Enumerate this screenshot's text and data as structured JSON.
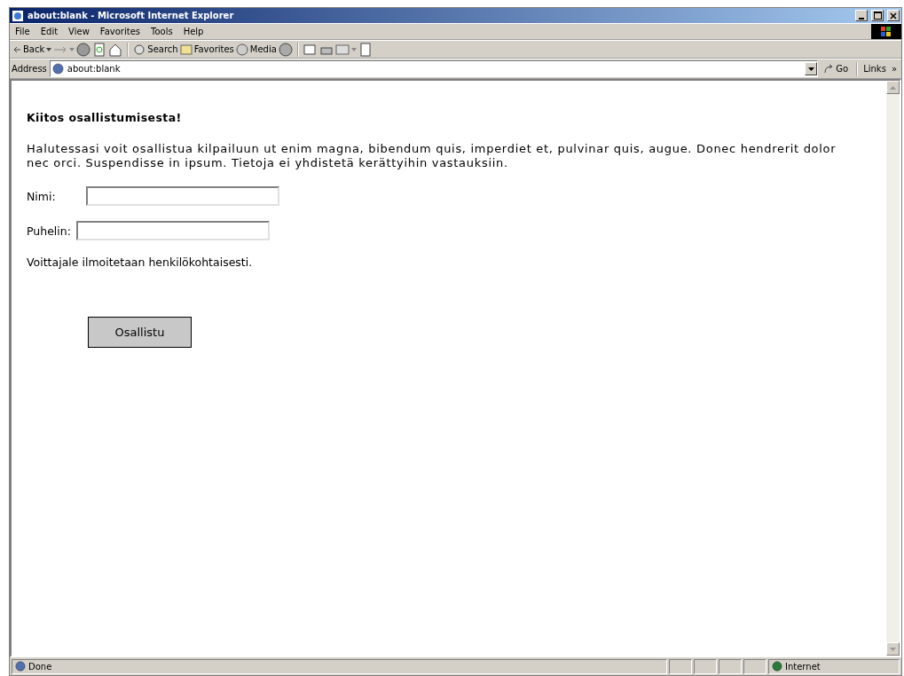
{
  "window": {
    "title": "about:blank - Microsoft Internet Explorer"
  },
  "menu": [
    "File",
    "Edit",
    "View",
    "Favorites",
    "Tools",
    "Help"
  ],
  "toolbar": {
    "back": "Back",
    "search": "Search",
    "favorites": "Favorites",
    "media": "Media"
  },
  "address_bar": {
    "label": "Address",
    "value": "about:blank",
    "go": "Go",
    "links": "Links",
    "more": "»"
  },
  "page": {
    "heading": "Kiitos osallistumisesta!",
    "paragraph": "Halutessasi voit osallistua kilpailuun ut enim magna, bibendum quis, imperdiet et, pulvinar quis, augue. Donec hendrerit dolor nec orci. Suspendisse in ipsum. Tietoja ei yhdistetä kerättyihin vastauksiin.",
    "fields": [
      {
        "label": "Nimi:"
      },
      {
        "label": "Puhelin:"
      }
    ],
    "note": "Voittajale ilmoitetaan henkilökohtaisesti.",
    "submit": "Osallistu"
  },
  "status_bar": {
    "text": "Done",
    "zone": "Internet"
  }
}
